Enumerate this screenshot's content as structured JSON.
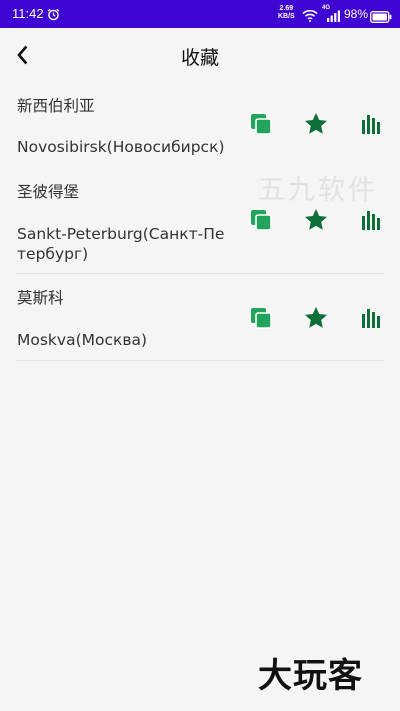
{
  "status_bar": {
    "time": "11:42",
    "net_speed_value": "2.69",
    "net_speed_unit": "KB/S",
    "network_type": "4G",
    "battery_percent": "98%",
    "background_color": "#3f05d2"
  },
  "header": {
    "title": "收藏",
    "back_icon": "chevron-left-icon"
  },
  "favorites": [
    {
      "name_cn": "新西伯利亚",
      "name_en": "Novosibirsk(Новосибирск)"
    },
    {
      "name_cn": "圣彼得堡",
      "name_en": "Sankt-Peterburg(Санкт-Петербург)"
    },
    {
      "name_cn": "莫斯科",
      "name_en": "Moskva(Москва)"
    }
  ],
  "actions": {
    "copy_icon": "copy-icon",
    "favorite_icon": "star-icon",
    "stats_icon": "bar-chart-icon",
    "copy_color": "#22a45d",
    "star_color": "#0e6e3a",
    "stats_color": "#0e6e3a"
  },
  "watermark": "五九软件",
  "brand": "大玩客"
}
